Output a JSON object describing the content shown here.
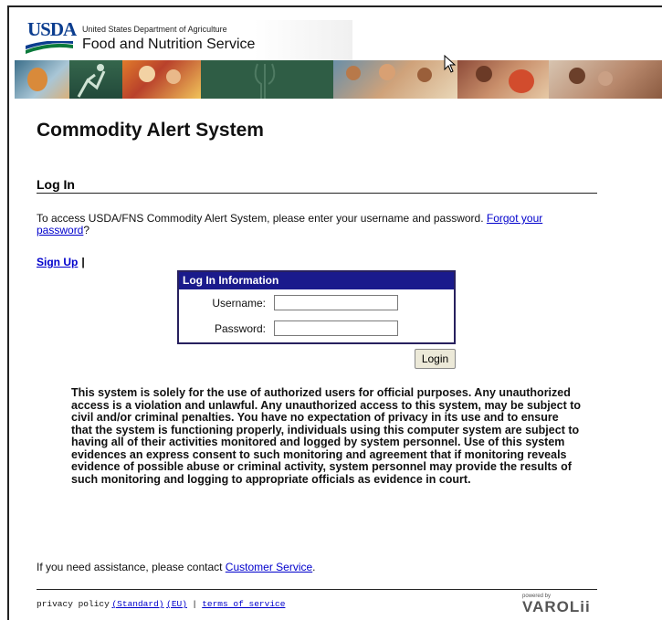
{
  "header": {
    "logo_text": "USDA",
    "agency_top": "United States Department of Agriculture",
    "agency_main": "Food and Nutrition Service"
  },
  "page": {
    "title": "Commodity Alert System",
    "section_title": "Log In",
    "intro_text": "To access USDA/FNS Commodity Alert System, please enter your username and password. ",
    "forgot_link": "Forgot your password",
    "intro_end": "?",
    "signup_link": "Sign Up",
    "signup_sep": "|"
  },
  "login_box": {
    "heading": "Log In Information",
    "username_label": "Username:",
    "username_value": "",
    "password_label": "Password:",
    "password_value": "",
    "submit_label": "Login"
  },
  "notice": "This system is solely for the use of authorized users for official purposes. Any unauthorized access is a violation and unlawful. Any unauthorized access to this system, may be subject to civil and/or criminal penalties. You have no expectation of privacy in its use and to ensure that the system is functioning properly, individuals using this computer system are subject to having all of their activities monitored and logged by system personnel. Use of this system evidences an express consent to such monitoring and agreement that if monitoring reveals evidence of possible abuse or criminal activity, system personnel may provide the results of such monitoring and logging to appropriate officials as evidence in court.",
  "assist": {
    "text": "If you need assistance, please contact ",
    "link": "Customer Service",
    "end": "."
  },
  "footer": {
    "privacy_label": "privacy policy",
    "standard_link": "(Standard)",
    "eu_link": "(EU)",
    "sep": "|",
    "terms_link": "terms of service",
    "powered_by": "powered by",
    "brand": "VAROLii"
  },
  "colors": {
    "login_header_bg": "#1a1a8c",
    "link": "#0000cc",
    "banner_green": "#2f5d45"
  }
}
